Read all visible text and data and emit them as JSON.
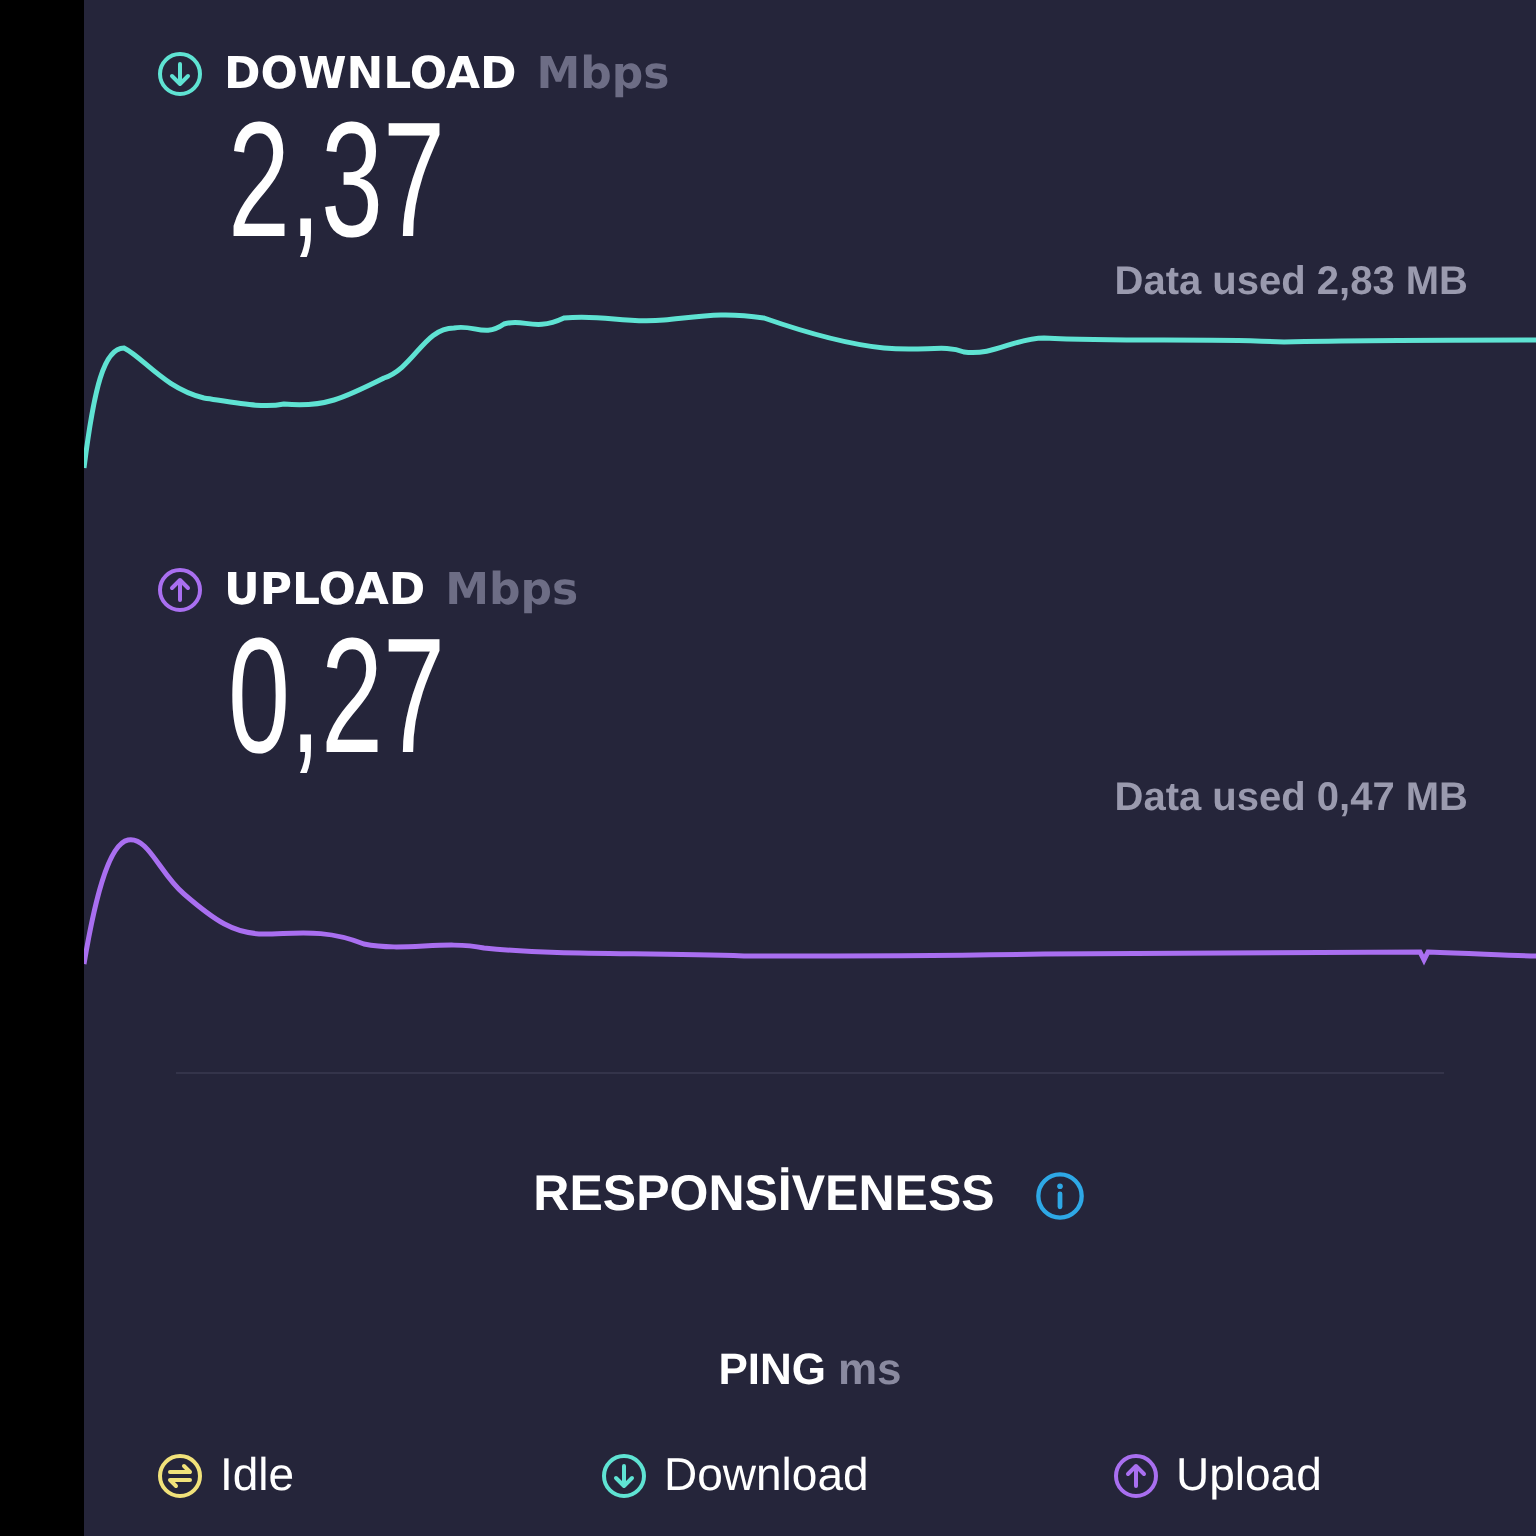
{
  "speeds": [
    {
      "kind": "download",
      "label": "DOWNLOAD",
      "unit": "Mbps",
      "value": "2,37",
      "data_used": "Data used 2,83 MB"
    },
    {
      "kind": "upload",
      "label": "UPLOAD",
      "unit": "Mbps",
      "value": "0,27",
      "data_used": "Data used 0,47 MB"
    }
  ],
  "responsiveness": {
    "title": "RESPONSİVENESS",
    "ping_label": "PING",
    "ping_unit": "ms",
    "legend": [
      {
        "kind": "idle",
        "label": "Idle"
      },
      {
        "kind": "download",
        "label": "Download"
      },
      {
        "kind": "upload",
        "label": "Upload"
      }
    ]
  }
}
